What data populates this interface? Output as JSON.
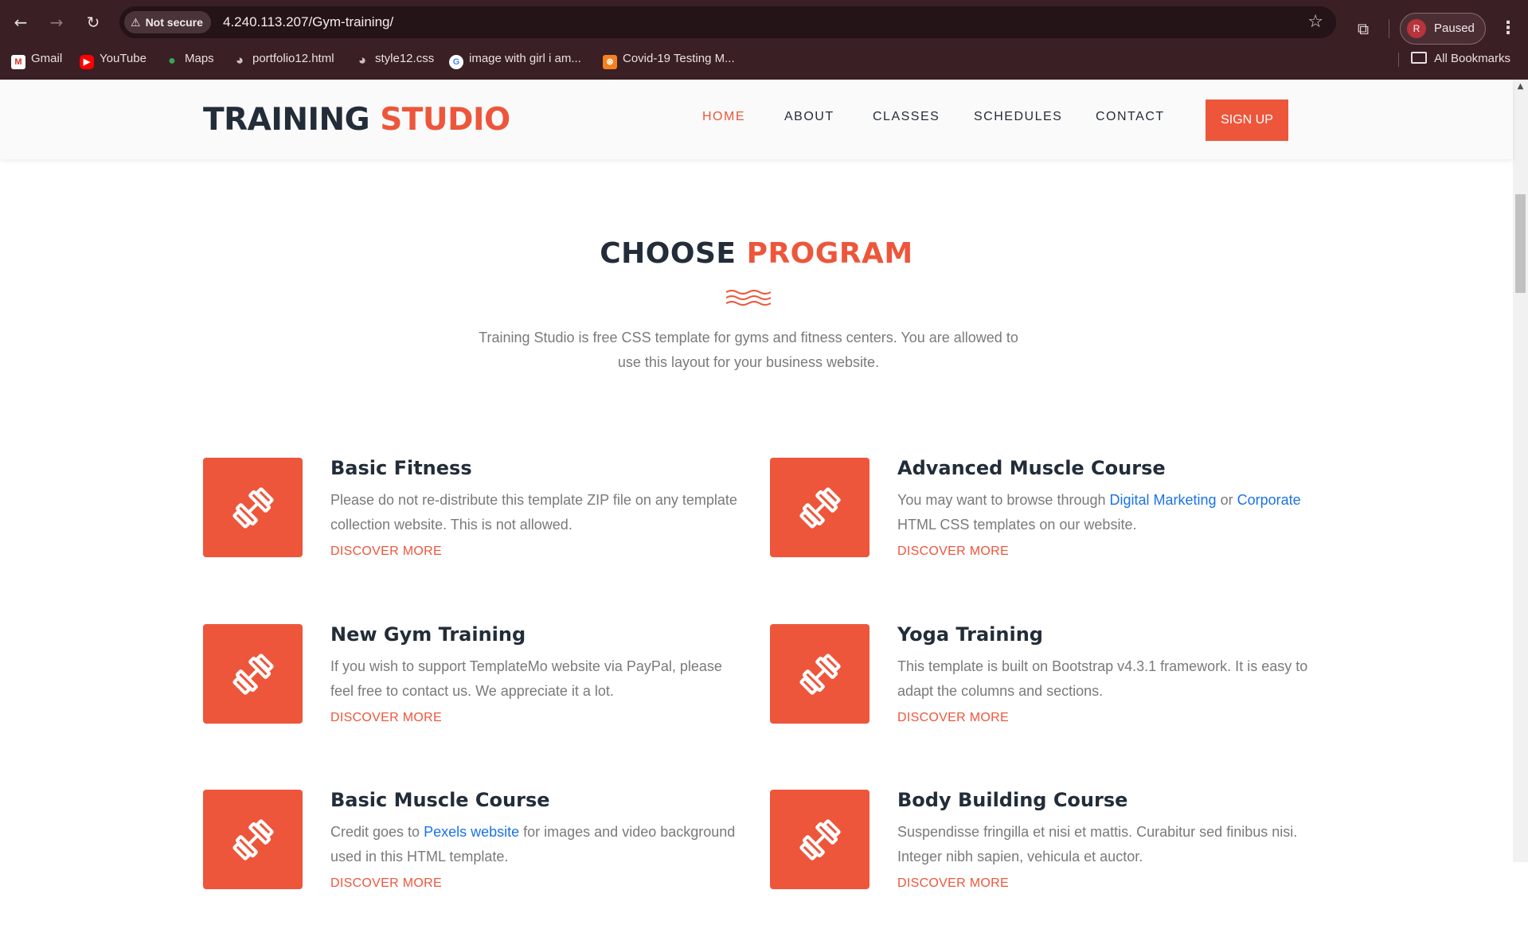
{
  "browser": {
    "security_label": "Not secure",
    "url": "4.240.113.207/Gym-training/",
    "profile_initial": "R",
    "profile_status": "Paused",
    "bookmarks": [
      {
        "label": "Gmail",
        "icon": "gmail-icon"
      },
      {
        "label": "YouTube",
        "icon": "youtube-icon"
      },
      {
        "label": "Maps",
        "icon": "maps-icon"
      },
      {
        "label": "portfolio12.html",
        "icon": "globe-icon"
      },
      {
        "label": "style12.css",
        "icon": "globe-icon"
      },
      {
        "label": "image with girl i am...",
        "icon": "google-icon"
      },
      {
        "label": "Covid-19 Testing M...",
        "icon": "covid-icon"
      }
    ],
    "all_bookmarks": "All Bookmarks"
  },
  "header": {
    "logo_primary": "TRAINING",
    "logo_accent": "STUDIO",
    "nav": [
      "HOME",
      "ABOUT",
      "CLASSES",
      "SCHEDULES",
      "CONTACT"
    ],
    "active_nav": "HOME",
    "signup_label": "SIGN UP"
  },
  "section": {
    "title_primary": "CHOOSE",
    "title_accent": "PROGRAM",
    "description": "Training Studio is free CSS template for gyms and fitness centers. You are allowed to use this layout for your business website."
  },
  "programs": [
    {
      "title": "Basic Fitness",
      "desc_parts": [
        "Please do not re-distribute this template ZIP file on any template collection website. This is not allowed."
      ],
      "more": "DISCOVER MORE"
    },
    {
      "title": "Advanced Muscle Course",
      "desc_parts": [
        "You may want to browse through ",
        "Digital Marketing",
        " or ",
        "Corporate",
        " HTML CSS templates on our website."
      ],
      "more": "DISCOVER MORE"
    },
    {
      "title": "New Gym Training",
      "desc_parts": [
        "If you wish to support TemplateMo website via PayPal, please feel free to contact us. We appreciate it a lot."
      ],
      "more": "DISCOVER MORE"
    },
    {
      "title": "Yoga Training",
      "desc_parts": [
        "This template is built on Bootstrap v4.3.1 framework. It is easy to adapt the columns and sections."
      ],
      "more": "DISCOVER MORE"
    },
    {
      "title": "Basic Muscle Course",
      "desc_parts": [
        "Credit goes to ",
        "Pexels website",
        " for images and video background used in this HTML template."
      ],
      "more": "DISCOVER MORE"
    },
    {
      "title": "Body Building Course",
      "desc_parts": [
        "Suspendisse fringilla et nisi et mattis. Curabitur sed finibus nisi. Integer nibh sapien, vehicula et auctor."
      ],
      "more": "DISCOVER MORE"
    }
  ],
  "colors": {
    "accent": "#ed563b",
    "dark": "#232d39",
    "text_muted": "#7a7a7a",
    "link": "#1a73e8",
    "chrome_bg": "#3a1f24"
  }
}
